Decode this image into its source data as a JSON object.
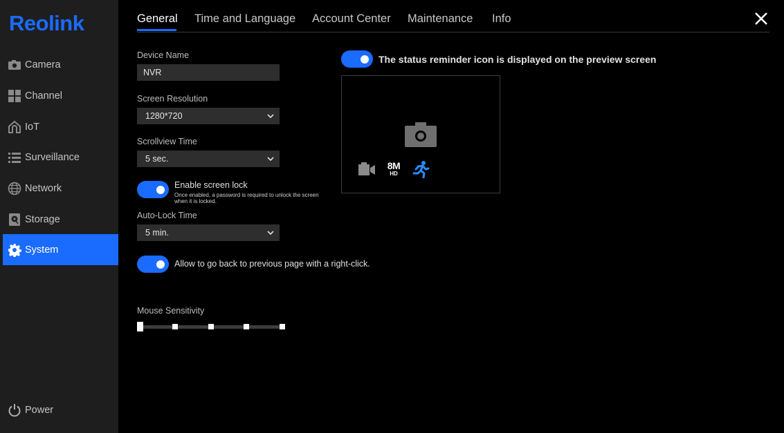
{
  "brand": {
    "logo": "Reolink"
  },
  "sidebar": {
    "items": [
      {
        "label": "Camera",
        "icon": "camera-icon"
      },
      {
        "label": "Channel",
        "icon": "grid-icon"
      },
      {
        "label": "IoT",
        "icon": "home-icon"
      },
      {
        "label": "Surveillance",
        "icon": "list-icon"
      },
      {
        "label": "Network",
        "icon": "globe-icon"
      },
      {
        "label": "Storage",
        "icon": "storage-icon"
      },
      {
        "label": "System",
        "icon": "gear-icon",
        "active": true
      }
    ],
    "power": {
      "label": "Power",
      "icon": "power-icon"
    }
  },
  "tabs": [
    {
      "label": "General",
      "active": true
    },
    {
      "label": "Time and Language"
    },
    {
      "label": "Account Center"
    },
    {
      "label": "Maintenance"
    },
    {
      "label": "Info"
    }
  ],
  "form": {
    "device_name": {
      "label": "Device Name",
      "value": "NVR"
    },
    "screen_resolution": {
      "label": "Screen Resolution",
      "value": "1280*720"
    },
    "scrollview_time": {
      "label": "Scrollview Time",
      "value": "5 sec."
    },
    "screen_lock": {
      "label": "Enable screen lock",
      "note": "Once enabled, a password is required to unlock the screen when it is locked.",
      "enabled": true
    },
    "auto_lock_time": {
      "label": "Auto-Lock Time",
      "value": "5 min."
    },
    "right_click_back": {
      "label": "Allow to go back to previous page with a right-click.",
      "enabled": true
    },
    "mouse_sensitivity": {
      "label": "Mouse Sensitivity",
      "level": 1,
      "levels": 5
    }
  },
  "status_reminder": {
    "label": "The status reminder icon is displayed on the preview screen",
    "enabled": true,
    "preview_icons": [
      "camera-icon",
      "video-record-icon",
      "8m-hd-icon",
      "motion-person-icon"
    ],
    "badge_text": {
      "top": "8M",
      "bottom": "HD"
    }
  },
  "colors": {
    "accent": "#1a6bff",
    "sidebar_bg": "#1e1e1e",
    "page_bg": "#000000",
    "field_bg": "#2e2e2e"
  }
}
